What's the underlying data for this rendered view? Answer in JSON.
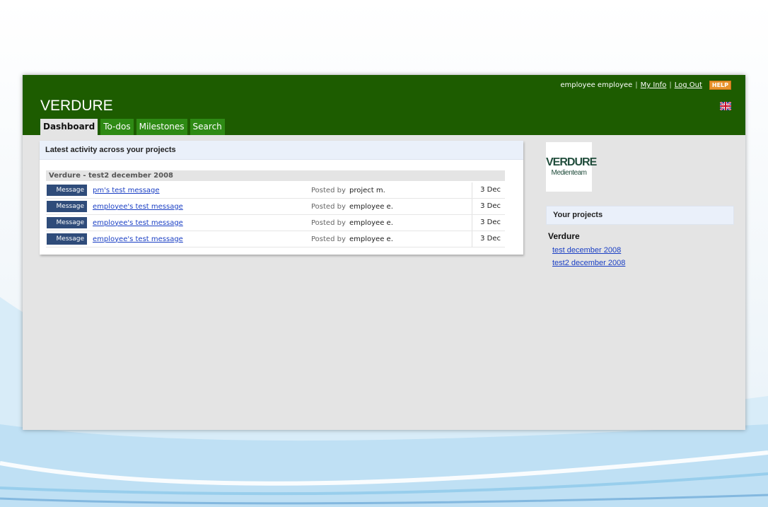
{
  "header": {
    "user_name": "employee employee",
    "my_info": "My Info",
    "log_out": "Log Out",
    "help": "HELP",
    "app_title": "VERDURE",
    "language_flag": "uk-flag-icon"
  },
  "tabs": [
    {
      "label": "Dashboard",
      "active": true
    },
    {
      "label": "To-dos",
      "active": false
    },
    {
      "label": "Milestones",
      "active": false
    },
    {
      "label": "Search",
      "active": false
    }
  ],
  "activity": {
    "title": "Latest activity across your projects",
    "group_title": "Verdure - test2 december 2008",
    "rows": [
      {
        "type": "Message",
        "title": "pm's test message",
        "posted_by_label": "Posted by",
        "author": "project m.",
        "date": "3 Dec"
      },
      {
        "type": "Message",
        "title": "employee's test message",
        "posted_by_label": "Posted by",
        "author": "employee e.",
        "date": "3 Dec"
      },
      {
        "type": "Message",
        "title": "employee's test message",
        "posted_by_label": "Posted by",
        "author": "employee e.",
        "date": "3 Dec"
      },
      {
        "type": "Message",
        "title": "employee's test message",
        "posted_by_label": "Posted by",
        "author": "employee e.",
        "date": "3 Dec"
      }
    ]
  },
  "sidebar": {
    "logo_line1": "VERDURE",
    "logo_line2": "Medienteam",
    "projects_title": "Your projects",
    "client_name": "Verdure",
    "projects": [
      "test december 2008",
      "test2 december 2008"
    ]
  },
  "colors": {
    "header_green": "#1d5c00",
    "tab_green": "#2e8a14",
    "badge_blue": "#2f4c7a",
    "link_blue": "#1a3fc4",
    "help_orange": "#e8922a"
  }
}
